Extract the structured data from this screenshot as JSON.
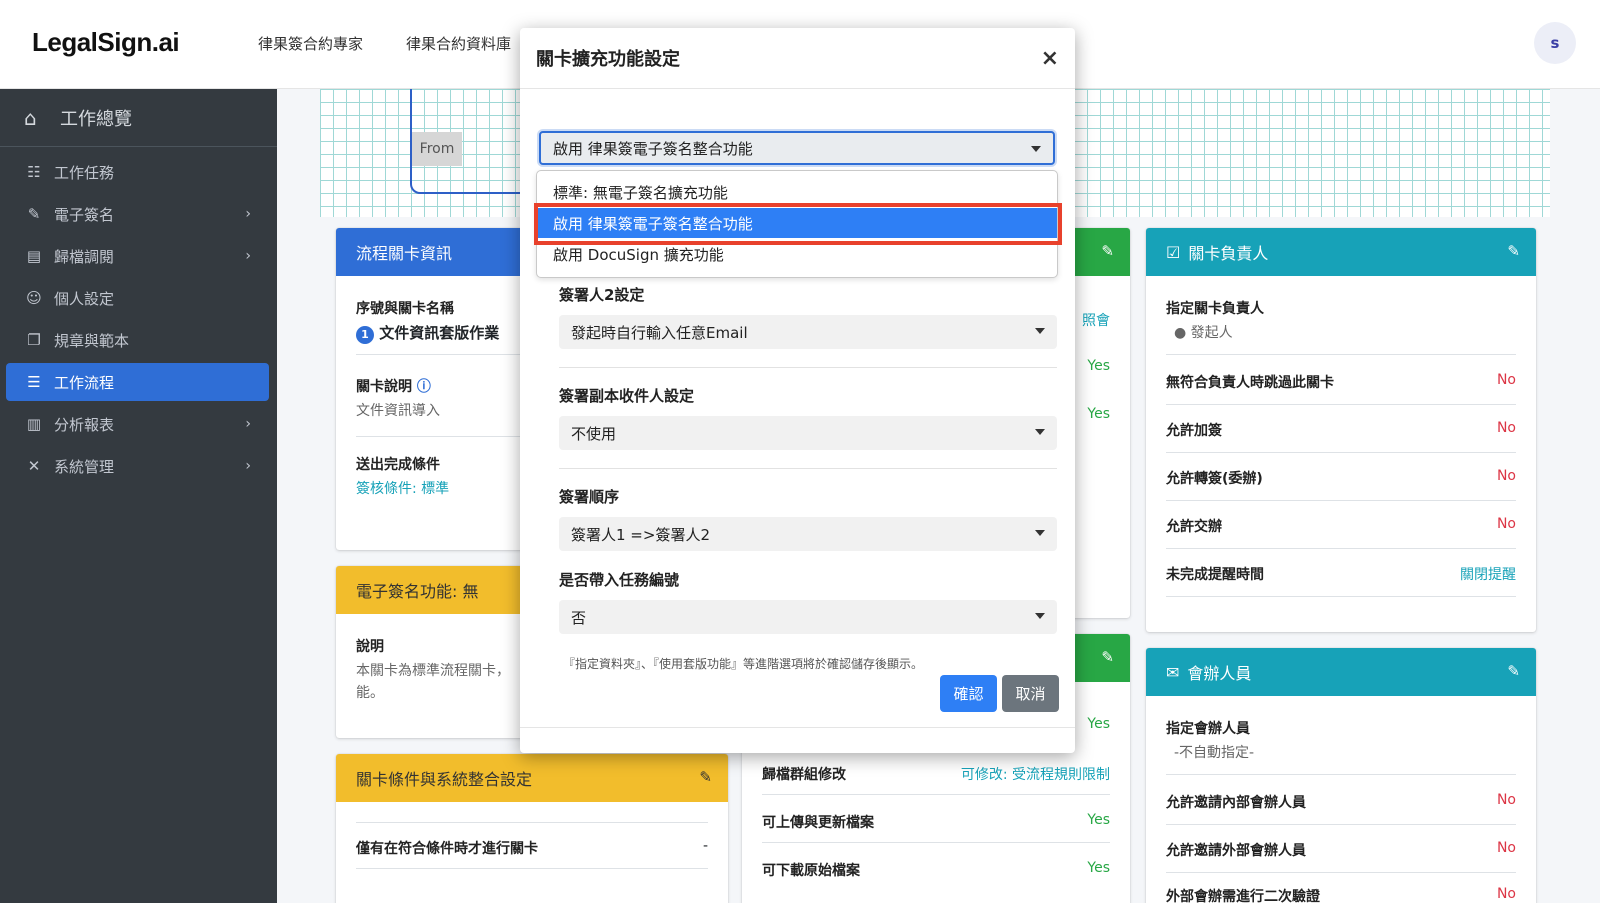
{
  "brand": "LegalSign.ai",
  "nav": {
    "link1": "律果簽合約專家",
    "link2": "律果合約資料庫",
    "avatar": "s"
  },
  "sidebar": {
    "header": "工作總覽",
    "items": [
      {
        "label": "工作任務"
      },
      {
        "label": "電子簽名"
      },
      {
        "label": "歸檔調閱"
      },
      {
        "label": "個人設定"
      },
      {
        "label": "規章與範本"
      },
      {
        "label": "工作流程"
      },
      {
        "label": "分析報表"
      },
      {
        "label": "系統管理"
      }
    ]
  },
  "canvas": {
    "node_label": "From"
  },
  "card_flow": {
    "title": "流程關卡資訊",
    "seq_label": "序號與關卡名稱",
    "seq_num": "1",
    "seq_name": "文件資訊套版作業",
    "desc_label": "關卡說明",
    "desc_value": "文件資訊導入",
    "cond_label": "送出完成條件",
    "cond_value": "簽核條件: 標準"
  },
  "card_esign": {
    "title": "電子簽名功能: 無",
    "desc_label": "說明",
    "desc_value_1": "本關卡為標準流程關卡，",
    "desc_value_2": "能。"
  },
  "card_cond": {
    "title": "關卡條件與系統整合設定",
    "row1_label": "僅有在符合條件時才進行關卡",
    "row1_value": "-"
  },
  "card_mid": {
    "v1": "照會",
    "v2": "Yes",
    "v3": "Yes",
    "v4": "Yes",
    "row_archive_label": "歸檔群組修改",
    "row_archive_value": "可修改: 受流程規則限制",
    "row_upload_label": "可上傳與更新檔案",
    "row_upload_value": "Yes",
    "row_download_label": "可下載原始檔案",
    "row_download_value": "Yes"
  },
  "card_owner": {
    "title": "關卡負責人",
    "assign_label": "指定關卡負責人",
    "assign_value": "發起人",
    "rows": [
      {
        "label": "無符合負責人時跳過此關卡",
        "value": "No"
      },
      {
        "label": "允許加簽",
        "value": "No"
      },
      {
        "label": "允許轉簽(委辦)",
        "value": "No"
      },
      {
        "label": "允許交辦",
        "value": "No"
      },
      {
        "label": "未完成提醒時間",
        "value": "關閉提醒"
      }
    ]
  },
  "card_co": {
    "title": "會辦人員",
    "assign_label": "指定會辦人員",
    "assign_value": "-不自動指定-",
    "rows": [
      {
        "label": "允許邀請內部會辦人員",
        "value": "No"
      },
      {
        "label": "允許邀請外部會辦人員",
        "value": "No"
      },
      {
        "label": "外部會辦需進行二次驗證",
        "value": "No"
      }
    ]
  },
  "modal": {
    "title": "關卡擴充功能設定",
    "close": "×",
    "ext_select_value": "啟用 律果簽電子簽名整合功能",
    "ext_options": [
      "標準: 無電子簽名擴充功能",
      "啟用 律果簽電子簽名整合功能",
      "啟用 DocuSign 擴充功能"
    ],
    "signer2_label": "簽署人2設定",
    "signer2_value": "發起時自行輸入任意Email",
    "cc_label": "簽署副本收件人設定",
    "cc_value": "不使用",
    "order_label": "簽署順序",
    "order_value": "簽署人1 =>簽署人2",
    "tasknum_label": "是否帶入任務編號",
    "tasknum_value": "否",
    "note": "『指定資料夾』、『使用套版功能』等進階選項將於確認儲存後顯示。",
    "confirm": "確認",
    "cancel": "取消"
  },
  "colors": {
    "primary": "#2f6ed6",
    "warning": "#f2bd2c",
    "info": "#17a2b8",
    "success": "#28a745",
    "danger": "#dc3545",
    "highlight": "#e8412c"
  }
}
